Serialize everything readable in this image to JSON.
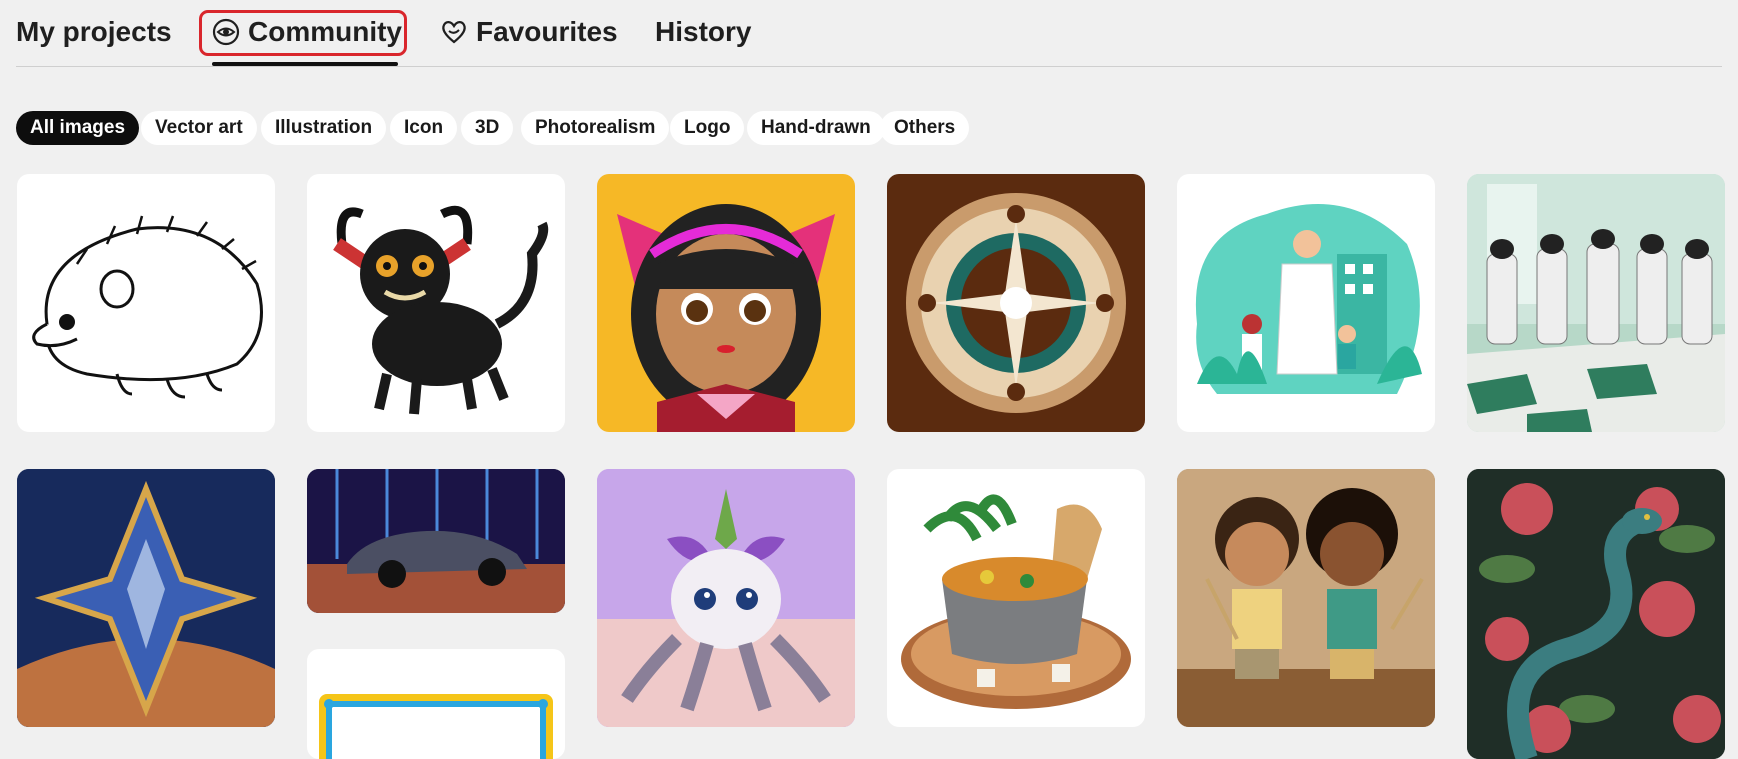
{
  "tabs": {
    "my_projects": "My projects",
    "community": "Community",
    "favourites": "Favourites",
    "history": "History"
  },
  "filters": [
    "All images",
    "Vector art",
    "Illustration",
    "Icon",
    "3D",
    "Photorealism",
    "Logo",
    "Hand-drawn",
    "Others"
  ],
  "active_filter": "All images",
  "gallery": [
    {
      "subject": "Hedgehog line drawing",
      "icon": "hedgehog-icon"
    },
    {
      "subject": "Black horned creature",
      "icon": "creature-icon"
    },
    {
      "subject": "Anime girl with bow",
      "icon": "girl-icon"
    },
    {
      "subject": "Compass rose emblem",
      "icon": "compass-icon"
    },
    {
      "subject": "Doctor and family",
      "icon": "doctor-icon"
    },
    {
      "subject": "Cows sweeping floor",
      "icon": "cows-icon"
    },
    {
      "subject": "Star emblem",
      "icon": "star-icon"
    },
    {
      "subject": "Neon car",
      "icon": "car-icon"
    },
    {
      "subject": "Plant creature",
      "icon": "plant-creature-icon"
    },
    {
      "subject": "Pot of stew",
      "icon": "stew-icon"
    },
    {
      "subject": "Two boys",
      "icon": "boys-icon"
    },
    {
      "subject": "Snake and roses",
      "icon": "snake-roses-icon"
    },
    {
      "subject": "Framed sign",
      "icon": "frame-icon"
    }
  ],
  "colors": {
    "accent_highlight": "#d9262c",
    "active_chip": "#0d0d0d",
    "background": "#f0f0f0"
  }
}
